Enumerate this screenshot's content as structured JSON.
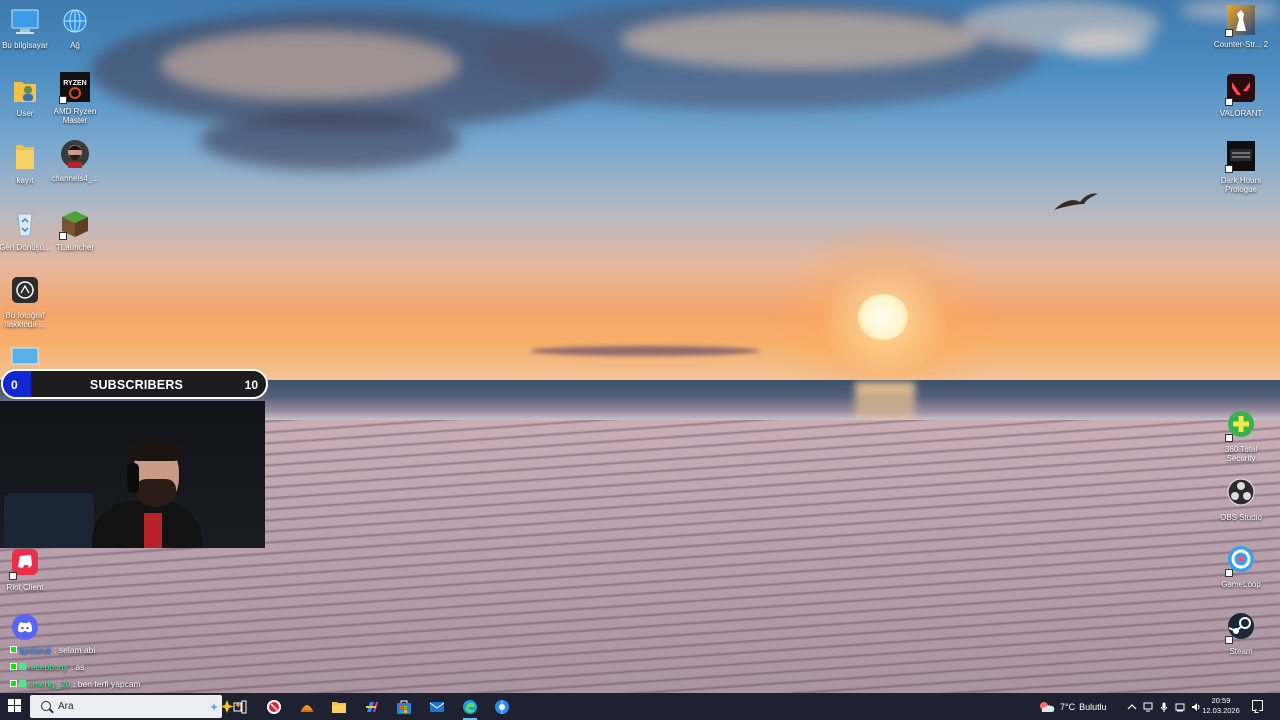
{
  "desktop": {
    "left_icons": [
      {
        "label": "Bu bilgisayar",
        "icon": "this-pc-icon"
      },
      {
        "label": "Ağ",
        "icon": "network-icon"
      },
      {
        "label": "User",
        "icon": "user-folder-icon"
      },
      {
        "label": "AMD Ryzen Master",
        "icon": "amd-ryzen-master-icon"
      },
      {
        "label": "kayıt",
        "icon": "folder-icon"
      },
      {
        "label": "channels4_...",
        "icon": "channel-image-icon"
      },
      {
        "label": "Geri Dönüşü...",
        "icon": "recycle-bin-icon"
      },
      {
        "label": "TLauncher",
        "icon": "tlauncher-icon"
      },
      {
        "label": "Bu fotoğraf hakkında ...",
        "icon": "about-photo-icon"
      },
      {
        "label": "Riot Client",
        "icon": "riot-client-icon"
      },
      {
        "label": "",
        "icon": "discord-icon"
      }
    ],
    "right_icons": [
      {
        "label": "Counter-Str... 2",
        "icon": "counter-strike-icon"
      },
      {
        "label": "VALORANT",
        "icon": "valorant-icon"
      },
      {
        "label": "Dark Hours Prologue",
        "icon": "dark-hours-icon"
      },
      {
        "label": "360 Total Security",
        "icon": "360-total-security-icon"
      },
      {
        "label": "OBS Studio",
        "icon": "obs-studio-icon"
      },
      {
        "label": "GameLoop",
        "icon": "gameloop-icon"
      },
      {
        "label": "Steam",
        "icon": "steam-icon"
      }
    ]
  },
  "overlay": {
    "subscribers": {
      "label": "SUBSCRIBERS",
      "current": "0",
      "goal": "10",
      "progress_fraction": 0.0,
      "fill_color": "#1226d6"
    },
    "chat": [
      {
        "user": "apolondi",
        "message": ": selam abi",
        "user_color": "#3f8cff"
      },
      {
        "user": "recepbuny",
        "message": ": as",
        "user_color": "#3cf08c"
      },
      {
        "user": "omerky_20",
        "message": ": ben terfi yapcam",
        "user_color": "#3cf08c"
      }
    ]
  },
  "taskbar": {
    "search_placeholder": "Ara",
    "apps": [
      {
        "name": "task-view-icon"
      },
      {
        "name": "recording-app-icon"
      },
      {
        "name": "orange-app-icon"
      },
      {
        "name": "file-explorer-icon"
      },
      {
        "name": "copilot-icon"
      },
      {
        "name": "microsoft-store-icon"
      },
      {
        "name": "mail-icon"
      },
      {
        "name": "edge-icon",
        "active": true
      },
      {
        "name": "browser-app-icon"
      }
    ],
    "weather": {
      "temperature": "7°C",
      "condition": "Bulutlu"
    },
    "clock": {
      "time": "20:59",
      "date": "12.03.2026"
    }
  },
  "colors": {
    "taskbar_bg": "#1e2230",
    "accent": "#76b9ed"
  }
}
